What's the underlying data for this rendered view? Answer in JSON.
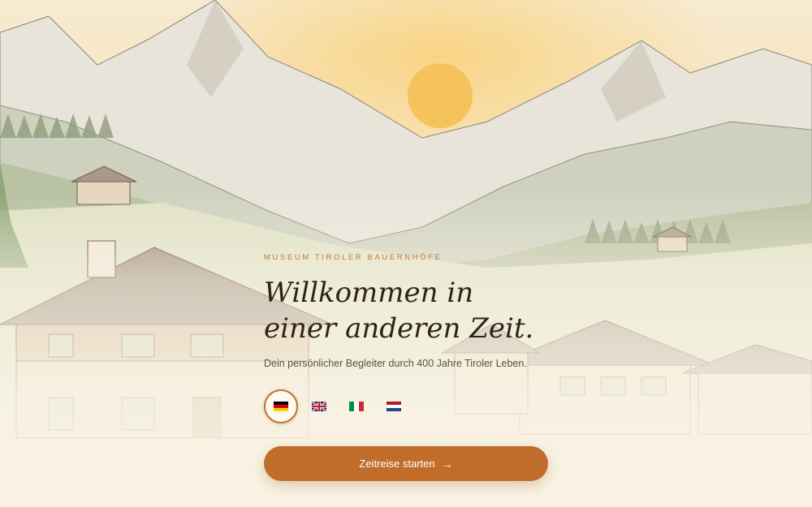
{
  "hero": {
    "eyebrow": "MUSEUM TIROLER BAUERNHÖFE",
    "title_line1": "Willkommen in",
    "title_line2": "einer anderen Zeit.",
    "subtitle": "Dein persönlicher Begleiter durch 400 Jahre Tiroler Leben."
  },
  "languages": [
    {
      "code": "de",
      "icon": "german-flag-icon",
      "selected": true
    },
    {
      "code": "en",
      "icon": "uk-flag-icon",
      "selected": false
    },
    {
      "code": "it",
      "icon": "italian-flag-icon",
      "selected": false
    },
    {
      "code": "nl",
      "icon": "dutch-flag-icon",
      "selected": false
    }
  ],
  "cta": {
    "label": "Zeitreise starten",
    "icon": "arrow-right-icon"
  },
  "colors": {
    "accent": "#c06d2b",
    "eyebrow": "#c07838",
    "title": "#2e2418",
    "subtitle": "#5a5046"
  }
}
